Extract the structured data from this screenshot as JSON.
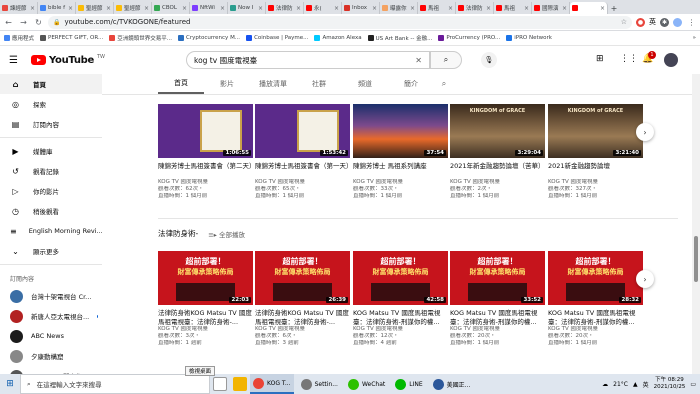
{
  "browser": {
    "tabs": [
      {
        "label": "諫經節",
        "color": "#e8453c",
        "active": false
      },
      {
        "label": "bible f",
        "color": "#4285f4",
        "active": false
      },
      {
        "label": "聖經節",
        "color": "#fbbc05",
        "active": false
      },
      {
        "label": "聖經節",
        "color": "#fbbc05",
        "active": false
      },
      {
        "label": "CBOL",
        "color": "#34a853",
        "active": false
      },
      {
        "label": "NftWi",
        "color": "#7d3cff",
        "active": false
      },
      {
        "label": "Now I",
        "color": "#2a9d8f",
        "active": false
      },
      {
        "label": "法律防",
        "color": "#ff0000",
        "active": false
      },
      {
        "label": "永(",
        "color": "#ff0000",
        "active": false
      },
      {
        "label": "Inbox",
        "color": "#d93025",
        "active": false
      },
      {
        "label": "曝露你",
        "color": "#f4a261",
        "active": false
      },
      {
        "label": "馬祖",
        "color": "#ff0000",
        "active": false
      },
      {
        "label": "法律防",
        "color": "#ff0000",
        "active": false
      },
      {
        "label": "馬祖",
        "color": "#ff0000",
        "active": false
      },
      {
        "label": "國際演",
        "color": "#ff0000",
        "active": false
      },
      {
        "label": "",
        "color": "#ff0000",
        "active": true
      }
    ],
    "new_tab": "+",
    "url": "youtube.com/c/TVKOGONE/featured",
    "bookmarks": [
      {
        "label": "應用程式",
        "color": "#4285f4"
      },
      {
        "label": "PERFECT GIFT, OR...",
        "color": "#555"
      },
      {
        "label": "亞洲鏡頭世界交易平...",
        "color": "#e8453c"
      },
      {
        "label": "Cryptocurrency M...",
        "color": "#2b6fc0"
      },
      {
        "label": "Coinbase | Payme...",
        "color": "#1652f0"
      },
      {
        "label": "Amazon Alexa",
        "color": "#00caff"
      },
      {
        "label": "US Art Bank -- 金融...",
        "color": "#222"
      },
      {
        "label": "ProCurrency (PRO...",
        "color": "#6a1b9a"
      },
      {
        "label": "iPRO Network",
        "color": "#1a73e8"
      }
    ],
    "more": "»"
  },
  "youtube": {
    "logo_text": "YouTube",
    "logo_region": "TW",
    "search_value": "kog tv 國度電視臺",
    "notif_count": "1"
  },
  "sidebar": {
    "items": [
      {
        "icon": "⌂",
        "label": "首頁",
        "name": "home"
      },
      {
        "icon": "◎",
        "label": "探索",
        "name": "explore"
      },
      {
        "icon": "▤",
        "label": "訂閱內容",
        "name": "subscriptions"
      }
    ],
    "items2": [
      {
        "icon": "▶",
        "label": "媒體庫",
        "name": "library"
      },
      {
        "icon": "↺",
        "label": "觀看記錄",
        "name": "history"
      },
      {
        "icon": "▷",
        "label": "你的影片",
        "name": "your-videos"
      },
      {
        "icon": "◷",
        "label": "稍後觀看",
        "name": "watch-later"
      },
      {
        "icon": "≡",
        "label": "English Morning Revi...",
        "name": "playlist"
      },
      {
        "icon": "⌄",
        "label": "顯示更多",
        "name": "show-more"
      }
    ],
    "subs_heading": "訂閱內容",
    "subs": [
      {
        "label": "台灣十架電視台 Cr...",
        "color": "#3a6ea5",
        "dot": true
      },
      {
        "label": "新唐人亞太電視台...",
        "color": "#b22222",
        "dot": true
      },
      {
        "label": "ABC News",
        "color": "#1c1c1c",
        "dot": false
      },
      {
        "label": "夕康動構窟",
        "color": "#888",
        "dot": false
      },
      {
        "label": "David Yen闡大衛",
        "color": "#555",
        "dot": false
      }
    ]
  },
  "channel_tabs": [
    "首頁",
    "影片",
    "播放清單",
    "社群",
    "頻道",
    "簡介"
  ],
  "row1": [
    {
      "title": "陳錦芳博士馬祖簽書會（第二天）",
      "channel": "KOG TV 國度電視臺",
      "views": "觀看次數：62次・",
      "date": "直播時間：1 個月前",
      "duration": "1:06:55",
      "style": "cert"
    },
    {
      "title": "陳錦芳博士馬祖簽書會（第一天）",
      "channel": "KOG TV 國度電視臺",
      "views": "觀看次數：65次・",
      "date": "直播時間：1 個月前",
      "duration": "1:53:42",
      "style": "cert"
    },
    {
      "title": "陳錦芳博士 馬祖系列講座",
      "channel": "KOG TV 國度電視臺",
      "views": "觀看次數：33次・",
      "date": "直播時間：1 個月前",
      "duration": "37:54",
      "style": "sunset"
    },
    {
      "title": "2021年新金融趨勢論壇（苦華）",
      "channel": "KOG TV 國度電視臺",
      "views": "觀看次數：2次・",
      "date": "直播時間：1 個月前",
      "duration": "3:29:04",
      "style": "grace",
      "thumb_text": "KINGDOM of GRACE"
    },
    {
      "title": "2021新金融趨勢論壇",
      "channel": "KOG TV 國度電視臺",
      "views": "觀看次數：327次・",
      "date": "直播時間：1 個月前",
      "duration": "3:21:40",
      "style": "grace",
      "thumb_text": "KINGDOM of GRACE"
    }
  ],
  "section2": {
    "title": "法律防身術-",
    "play_all": "全部播放"
  },
  "row2": [
    {
      "title": "法律防身術KOG Matsu TV 國度馬祖電視臺：法律防身術-...",
      "channel": "KOG TV 國度電視臺",
      "views": "觀看次數：3次・",
      "date": "直播時間：1 週前",
      "duration": "22:03"
    },
    {
      "title": "法律防身術KOG Matsu TV 國度馬祖電視臺：法律防身術-...",
      "channel": "KOG TV 國度電視臺",
      "views": "觀看次數：6次・",
      "date": "直播時間：3 週前",
      "duration": "26:39"
    },
    {
      "title": "KOG Matsu TV 國度馬祖電視臺：法律防身術-刑謀你的權...",
      "channel": "KOG TV 國度電視臺",
      "views": "觀看次數：12次・",
      "date": "直播時間：4 週前",
      "duration": "42:58"
    },
    {
      "title": "KOG Matsu TV 國度馬祖電視臺：法律防身術-刑謀你的權...",
      "channel": "KOG TV 國度電視臺",
      "views": "觀看次數：20次・",
      "date": "直播時間：1 個月前",
      "duration": "33:52"
    },
    {
      "title": "KOG Matsu TV 國度馬祖電視臺：法律防身術-刑謀你的權...",
      "channel": "KOG TV 國度電視臺",
      "views": "觀看次數：20次・",
      "date": "直播時間：1 個月前",
      "duration": "28:32"
    }
  ],
  "thumb_red_line1": "超前部署！",
  "thumb_red_line2": "財富傳承策略佈局",
  "taskbar": {
    "search_placeholder": "在這裡輸入文字來搜尋",
    "tooltip": "檢視桌面",
    "apps": [
      {
        "label": "KOG T...",
        "color": "#ea4335",
        "active": true
      },
      {
        "label": "Settin...",
        "color": "#777",
        "active": false
      },
      {
        "label": "WeChat",
        "color": "#2dc100",
        "active": false
      },
      {
        "label": "LINE",
        "color": "#00b900",
        "active": false
      },
      {
        "label": "美國正...",
        "color": "#2b579a",
        "active": false
      }
    ],
    "temp": "21°C",
    "ime": "英",
    "time": "下午 08:29",
    "date": "2021/10/25"
  }
}
